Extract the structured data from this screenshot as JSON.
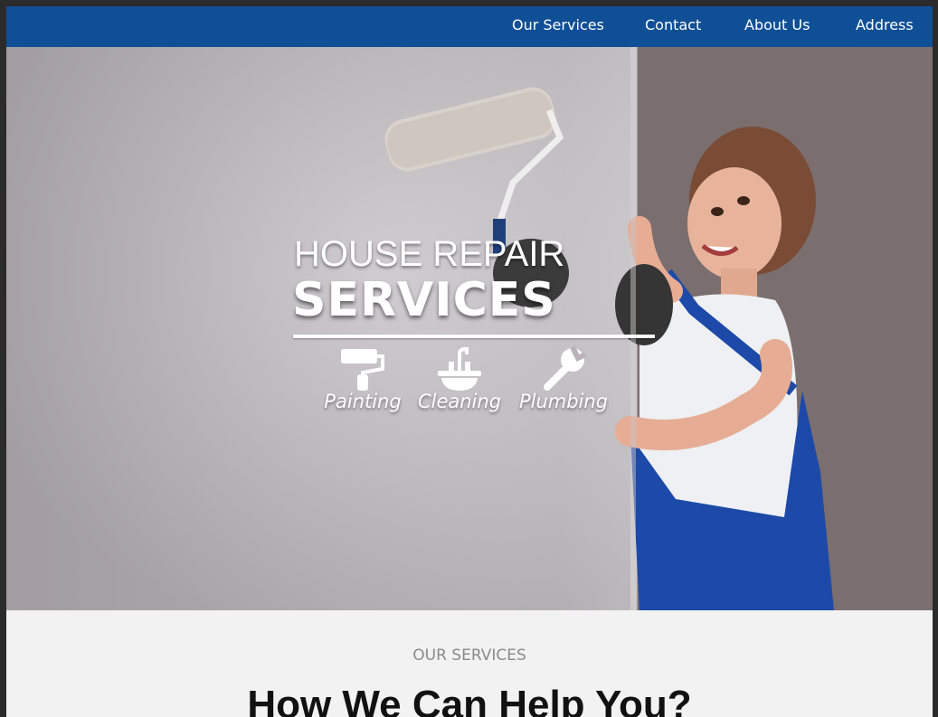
{
  "nav": {
    "items": [
      {
        "label": "Our Services"
      },
      {
        "label": "Contact"
      },
      {
        "label": "About Us"
      },
      {
        "label": "Address"
      }
    ]
  },
  "hero": {
    "title_line1": "HOUSE REPAIR",
    "title_line2": "SERVICES",
    "services": [
      {
        "label": "Painting",
        "icon": "paint-roller-icon"
      },
      {
        "label": "Cleaning",
        "icon": "sink-faucet-icon"
      },
      {
        "label": "Plumbing",
        "icon": "wrench-icon"
      }
    ]
  },
  "services_section": {
    "eyebrow": "OUR SERVICES",
    "heading": "How We Can Help You?"
  },
  "colors": {
    "nav_bg": "#0f4f96",
    "section_bg": "#f2f2f2",
    "frame_bg": "#2b2b2b"
  }
}
